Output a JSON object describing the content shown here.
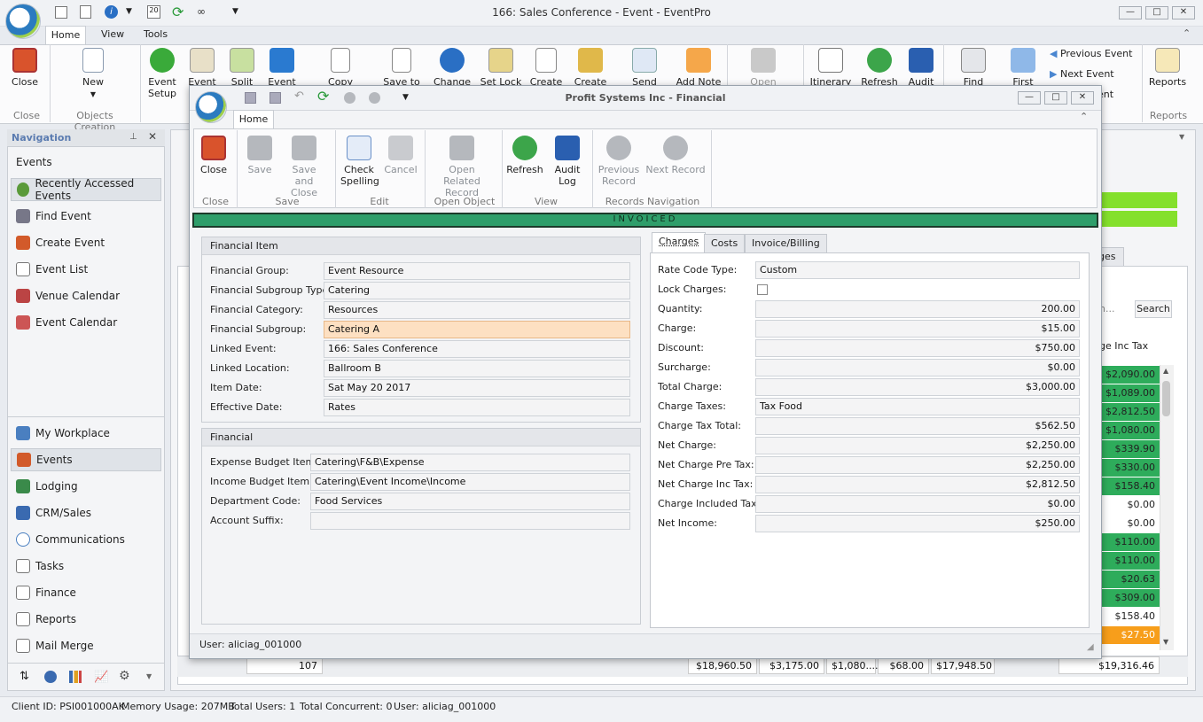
{
  "window": {
    "title": "166: Sales Conference - Event - EventPro"
  },
  "ribbon": {
    "tabs": [
      "Home",
      "View",
      "Tools"
    ],
    "buttons": {
      "close": "Close",
      "new": "New",
      "event_setup": "Event Setup",
      "event": "Event",
      "split": "Split",
      "event2": "Event",
      "copy_template": "Copy Template",
      "save_to": "Save to",
      "change": "Change",
      "set_lock": "Set Lock",
      "create1": "Create",
      "create2": "Create",
      "send_email": "Send Email",
      "add_note": "Add Note",
      "open_related": "Open Related",
      "itinerary": "Itinerary",
      "refresh": "Refresh",
      "audit": "Audit",
      "find_event": "Find Event",
      "first": "First",
      "previous_event": "Previous Event",
      "next_event": "Next Event",
      "last_event": "ent",
      "reports": "Reports"
    },
    "groups": {
      "close": "Close",
      "objects_creation": "Objects Creation",
      "reports": "Reports"
    }
  },
  "navigation": {
    "header": "Navigation",
    "section": "Events",
    "top_items": [
      "Recently Accessed Events",
      "Find Event",
      "Create Event",
      "Event List",
      "Venue Calendar",
      "Event Calendar"
    ],
    "modules": [
      "My Workplace",
      "Events",
      "Lodging",
      "CRM/Sales",
      "Communications",
      "Tasks",
      "Finance",
      "Reports",
      "Mail Merge"
    ]
  },
  "background_grid": {
    "tab_fragment": "ges",
    "search_placeholder": "h...",
    "search_button": "Search",
    "column_header": "ge Inc Tax",
    "rows": [
      {
        "value": "$2,090.00",
        "color": "#2eac5b"
      },
      {
        "value": "$1,089.00",
        "color": "#2eac5b"
      },
      {
        "value": "$2,812.50",
        "color": "#2eac5b"
      },
      {
        "value": "$1,080.00",
        "color": "#2eac5b"
      },
      {
        "value": "$339.90",
        "color": "#2eac5b"
      },
      {
        "value": "$330.00",
        "color": "#2eac5b"
      },
      {
        "value": "$158.40",
        "color": "#2eac5b"
      },
      {
        "value": "$0.00",
        "color": "#ffffff"
      },
      {
        "value": "$0.00",
        "color": "#ffffff"
      },
      {
        "value": "$110.00",
        "color": "#2eac5b"
      },
      {
        "value": "$110.00",
        "color": "#2eac5b"
      },
      {
        "value": "$20.63",
        "color": "#2eac5b"
      },
      {
        "value": "$309.00",
        "color": "#2eac5b"
      },
      {
        "value": "$158.40",
        "color": "#ffffff"
      },
      {
        "value": "$27.50",
        "color": "#f79e1b"
      }
    ],
    "footer": [
      "107",
      "$18,960.50",
      "$3,175.00",
      "$1,080....",
      "$68.00",
      "$17,948.50",
      "$19,316.46"
    ]
  },
  "status_bar": {
    "client_id": "Client ID: PSI001000AK",
    "memory": "Memory Usage: 207MB",
    "total_users": "Total Users: 1",
    "total_concurrent": "Total Concurrent: 0",
    "user": "User: aliciag_001000"
  },
  "dialog": {
    "title": "Profit Systems Inc - Financial",
    "tab": "Home",
    "buttons": {
      "close": "Close",
      "save": "Save",
      "save_and_close": "Save and Close",
      "check_spelling": "Check Spelling",
      "cancel": "Cancel",
      "open_related_record": "Open Related Record",
      "refresh": "Refresh",
      "audit_log": "Audit Log",
      "previous_record": "Previous Record",
      "next_record": "Next Record"
    },
    "groups": {
      "close": "Close",
      "save": "Save",
      "edit": "Edit",
      "open_object": "Open Object",
      "view": "View",
      "records_navigation": "Records Navigation"
    },
    "status_banner": "INVOICED",
    "financial_item": {
      "header": "Financial Item",
      "fields": [
        {
          "label": "Financial Group:",
          "value": "Event Resource"
        },
        {
          "label": "Financial Subgroup Type:",
          "value": "Catering"
        },
        {
          "label": "Financial Category:",
          "value": "Resources"
        },
        {
          "label": "Financial Subgroup:",
          "value": "Catering A"
        },
        {
          "label": "Linked Event:",
          "value": "166: Sales Conference"
        },
        {
          "label": "Linked Location:",
          "value": "Ballroom B"
        },
        {
          "label": "Item Date:",
          "value": "Sat May 20 2017"
        },
        {
          "label": "Effective Date:",
          "value": "Rates"
        }
      ]
    },
    "financial": {
      "header": "Financial",
      "fields": [
        {
          "label": "Expense Budget Item:",
          "value": "Catering\\F&B\\Expense"
        },
        {
          "label": "Income Budget Item:",
          "value": "Catering\\Event Income\\Income"
        },
        {
          "label": "Department Code:",
          "value": "Food Services"
        },
        {
          "label": "Account Suffix:",
          "value": ""
        }
      ]
    },
    "charges_tabs": [
      "Charges",
      "Costs",
      "Invoice/Billing"
    ],
    "charges": {
      "rate_code_type": {
        "label": "Rate Code Type:",
        "value": "Custom"
      },
      "lock_charges": {
        "label": "Lock Charges:"
      },
      "rows": [
        {
          "label": "Quantity:",
          "value": "200.00"
        },
        {
          "label": "Charge:",
          "value": "$15.00"
        },
        {
          "label": "Discount:",
          "value": "$750.00"
        },
        {
          "label": "Surcharge:",
          "value": "$0.00"
        },
        {
          "label": "Total Charge:",
          "value": "$3,000.00"
        }
      ],
      "charge_taxes": {
        "label": "Charge Taxes:",
        "value": "Tax Food"
      },
      "rows2": [
        {
          "label": "Charge Tax Total:",
          "value": "$562.50"
        },
        {
          "label": "Net Charge:",
          "value": "$2,250.00"
        },
        {
          "label": "Net Charge Pre Tax:",
          "value": "$2,250.00"
        },
        {
          "label": "Net Charge Inc Tax:",
          "value": "$2,812.50"
        },
        {
          "label": "Charge Included Tax:",
          "value": "$0.00"
        },
        {
          "label": "Net Income:",
          "value": "$250.00"
        }
      ]
    },
    "user": "User: aliciag_001000"
  }
}
